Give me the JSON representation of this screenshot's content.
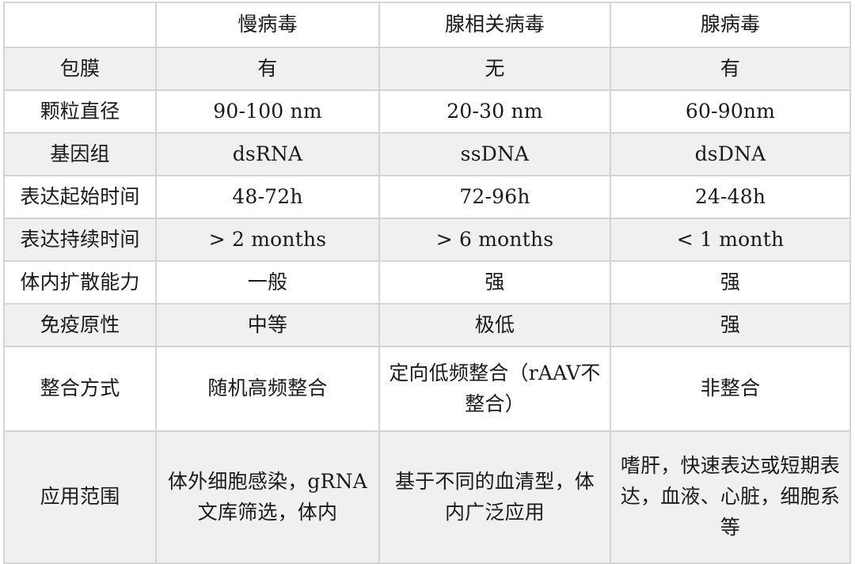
{
  "table": {
    "headers": [
      "",
      "慢病毒",
      "腺相关病毒",
      "腺病毒"
    ],
    "rows": [
      {
        "label": "包膜",
        "values": [
          "有",
          "无",
          "有"
        ],
        "striped": true,
        "size": "simple"
      },
      {
        "label": "颗粒直径",
        "values": [
          "90-100 nm",
          "20-30 nm",
          "60-90nm"
        ],
        "striped": false,
        "size": "simple"
      },
      {
        "label": "基因组",
        "values": [
          "dsRNA",
          "ssDNA",
          "dsDNA"
        ],
        "striped": true,
        "size": "simple"
      },
      {
        "label": "表达起始时间",
        "values": [
          "48-72h",
          "72-96h",
          "24-48h"
        ],
        "striped": false,
        "size": "simple"
      },
      {
        "label": "表达持续时间",
        "values": [
          "> 2 months",
          "> 6 months",
          "< 1 month"
        ],
        "striped": true,
        "size": "simple"
      },
      {
        "label": "体内扩散能力",
        "values": [
          "一般",
          "强",
          "强"
        ],
        "striped": false,
        "size": "simple"
      },
      {
        "label": "免疫原性",
        "values": [
          "中等",
          "极低",
          "强"
        ],
        "striped": true,
        "size": "simple"
      },
      {
        "label": "整合方式",
        "values": [
          "随机高频整合",
          "定向低频整合（rAAV不整合）",
          "非整合"
        ],
        "striped": false,
        "size": "tall"
      },
      {
        "label": "应用范围",
        "values": [
          "体外细胞感染，gRNA文库筛选，体内",
          "基于不同的血清型，体内广泛应用",
          "嗜肝，快速表达或短期表达，血液、心脏，细胞系等"
        ],
        "striped": true,
        "size": "xtall"
      }
    ]
  },
  "colors": {
    "border": "#d4d4d4",
    "stripe": "#f0f0f0",
    "background": "#ffffff",
    "text": "#1a1a1a"
  }
}
